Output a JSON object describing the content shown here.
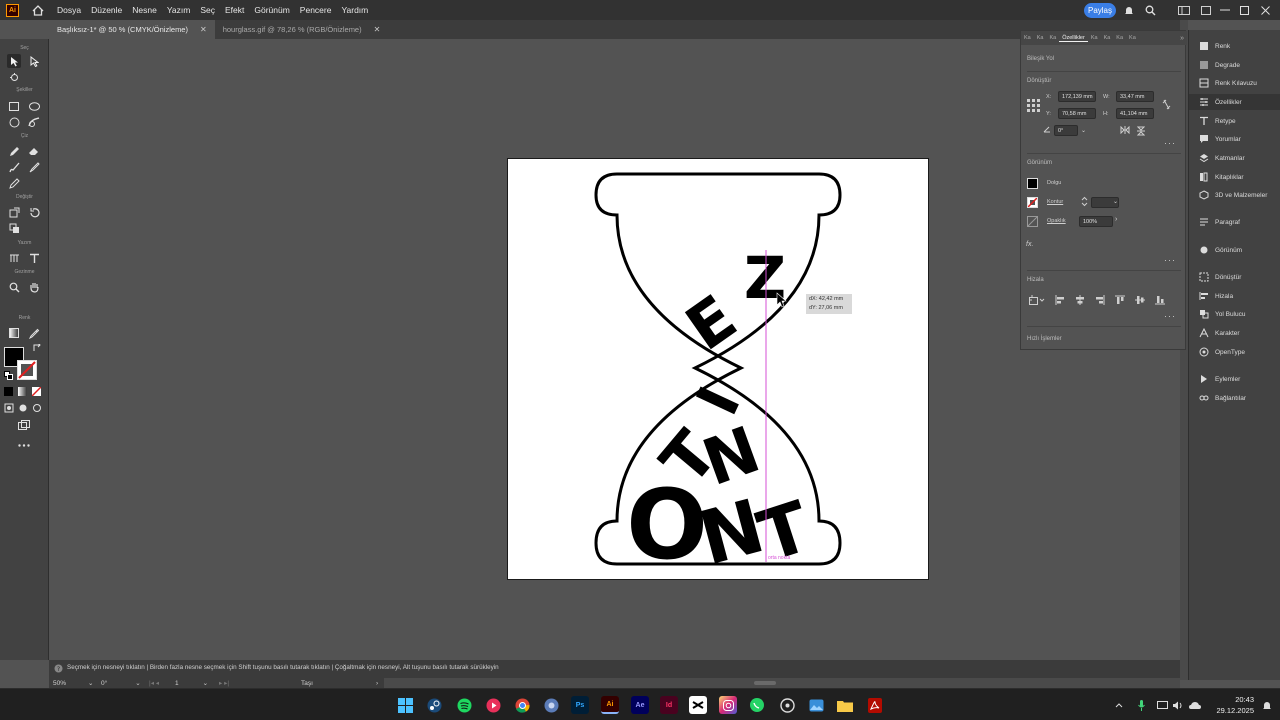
{
  "app": {
    "logo": "Ai"
  },
  "menu": {
    "items": [
      "Dosya",
      "Düzenle",
      "Nesne",
      "Yazım",
      "Seç",
      "Efekt",
      "Görünüm",
      "Pencere",
      "Yardım"
    ],
    "share_label": "Paylaş"
  },
  "tabs": [
    {
      "label": "Başlıksız-1* @ 50 % (CMYK/Önizleme)",
      "active": true
    },
    {
      "label": "hourglass.gif @ 78,26 % (RGB/Önizleme)",
      "active": false
    }
  ],
  "toolbar": {
    "sections": [
      "Seç",
      "Şekiller",
      "Çiz",
      "Değiştir",
      "Yazım",
      "Gezinme",
      "Renk"
    ]
  },
  "canvas": {
    "letters": [
      "Z",
      "E",
      "I",
      "N",
      "T",
      "T",
      "N",
      "O"
    ],
    "tooltip": {
      "dx": "dX: 42,42 mm",
      "dy": "dY: 27,06 mm"
    },
    "guide_label": "orta nokta"
  },
  "properties": {
    "tabs": [
      "Ka",
      "Ka",
      "Ka",
      "Özellikler",
      "Ka",
      "Ka",
      "Ka",
      "Ka"
    ],
    "selection_type": "Bileşik Yol",
    "transform_title": "Dönüştür",
    "x_label": "X:",
    "x_value": "172,139 mm",
    "y_label": "Y:",
    "y_value": "70,58 mm",
    "w_label": "W:",
    "w_value": "33,47 mm",
    "h_label": "H:",
    "h_value": "41,104 mm",
    "angle_value": "0°",
    "appearance_title": "Görünüm",
    "fill_label": "Dolgu",
    "stroke_label": "Kontur",
    "opacity_label": "Opaklık",
    "opacity_value": "100%",
    "fx_label": "fx.",
    "align_title": "Hizala",
    "quick_actions_title": "Hızlı İşlemler"
  },
  "right_panel": {
    "items": [
      "Renk",
      "Degrade",
      "Renk Kılavuzu",
      "Özellikler",
      "Retype",
      "Yorumlar",
      "Katmanlar",
      "Kitaplıklar",
      "3D ve Malzemeler",
      "Paragraf",
      "Görünüm",
      "Dönüştür",
      "Hizala",
      "Yol Bulucu",
      "Karakter",
      "OpenType",
      "Eylemler",
      "Bağlantılar"
    ],
    "selected": "Özellikler"
  },
  "status": {
    "hint": "Seçmek için nesneyi tıklatın | Birden fazla nesne seçmek için Shift tuşunu basılı tutarak tıklatın | Çoğaltmak için nesneyi, Alt tuşunu basılı tutarak sürükleyin",
    "zoom": "50%",
    "rotation": "0°",
    "artboard": "1",
    "mode": "Taşı"
  },
  "taskbar": {
    "time": "20:43",
    "date": "29.12.2025"
  },
  "colors": {
    "accent": "#3a7ee6",
    "ai_orange": "#ff9a00",
    "guide": "#d64fd6"
  }
}
